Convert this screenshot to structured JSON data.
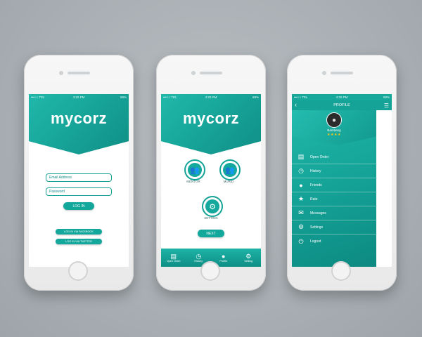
{
  "status": {
    "carrier": "•••○○ TEL",
    "time": "4:20 PM",
    "battery": "69%"
  },
  "app": {
    "logo": "mycorz",
    "brand_color": "#14a79b"
  },
  "login": {
    "email_placeholder": "Email Address",
    "password_placeholder": "Password",
    "login_button": "LOG IN",
    "facebook_button": "LOG IN VIA FACEBOOK",
    "twitter_button": "LOG IN VIA TWITTER"
  },
  "select": {
    "mentor": "MENTOR",
    "murid": "MURID",
    "setting": "SETTING",
    "next": "NEXT"
  },
  "tabs": [
    {
      "label": "Open Order",
      "icon": "document-icon"
    },
    {
      "label": "History",
      "icon": "clock-icon"
    },
    {
      "label": "Profile",
      "icon": "user-icon"
    },
    {
      "label": "Setting",
      "icon": "gear-icon"
    }
  ],
  "profile": {
    "title": "PROFILE",
    "name": "Bambang",
    "stars": "★★★★",
    "menu": [
      {
        "label": "Open Order",
        "icon": "document-icon"
      },
      {
        "label": "History",
        "icon": "clock-icon"
      },
      {
        "label": "Friends",
        "icon": "user-icon"
      },
      {
        "label": "Rate",
        "icon": "star-icon"
      },
      {
        "label": "Messages",
        "icon": "envelope-icon"
      },
      {
        "label": "Settings",
        "icon": "gear-icon"
      },
      {
        "label": "Logout",
        "icon": "power-icon"
      }
    ]
  }
}
